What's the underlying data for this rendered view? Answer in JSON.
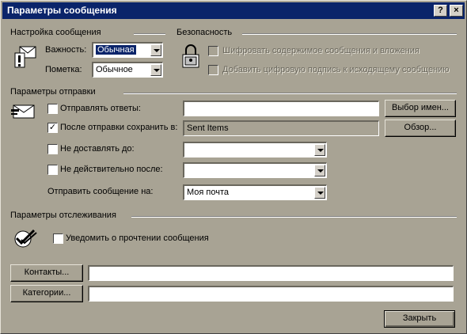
{
  "dialog": {
    "title": "Параметры сообщения",
    "help_label": "?",
    "close_label": "×"
  },
  "message_settings": {
    "heading": "Настройка сообщения",
    "importance_label": "Важность:",
    "importance_value": "Обычная",
    "sensitivity_label": "Пометка:",
    "sensitivity_value": "Обычное"
  },
  "security": {
    "heading": "Безопасность",
    "encrypt_label": "Шифровать содержимое сообщения и вложения",
    "sign_label": "Добавить цифровую подпись к исходящему сообщению",
    "encrypt_checked": false,
    "sign_checked": false
  },
  "delivery": {
    "heading": "Параметры отправки",
    "replies_label": "Отправлять ответы:",
    "replies_value": "",
    "replies_checked": false,
    "select_names_button": "Выбор имен...",
    "save_sent_label": "После отправки сохранить в:",
    "save_sent_value": "Sent Items",
    "save_sent_checked": true,
    "browse_button": "Обзор...",
    "do_not_deliver_label": "Не доставлять до:",
    "do_not_deliver_value": "",
    "expires_label": "Не действительно после:",
    "expires_value": "",
    "send_using_label": "Отправить сообщение на:",
    "send_using_value": "Моя почта",
    "check_mark": "✓"
  },
  "tracking": {
    "heading": "Параметры отслеживания",
    "read_receipt_label": "Уведомить о прочтении сообщения",
    "read_receipt_checked": false
  },
  "footer": {
    "contacts_button": "Контакты...",
    "contacts_value": "",
    "categories_button": "Категории...",
    "categories_value": "",
    "close_button": "Закрыть"
  }
}
